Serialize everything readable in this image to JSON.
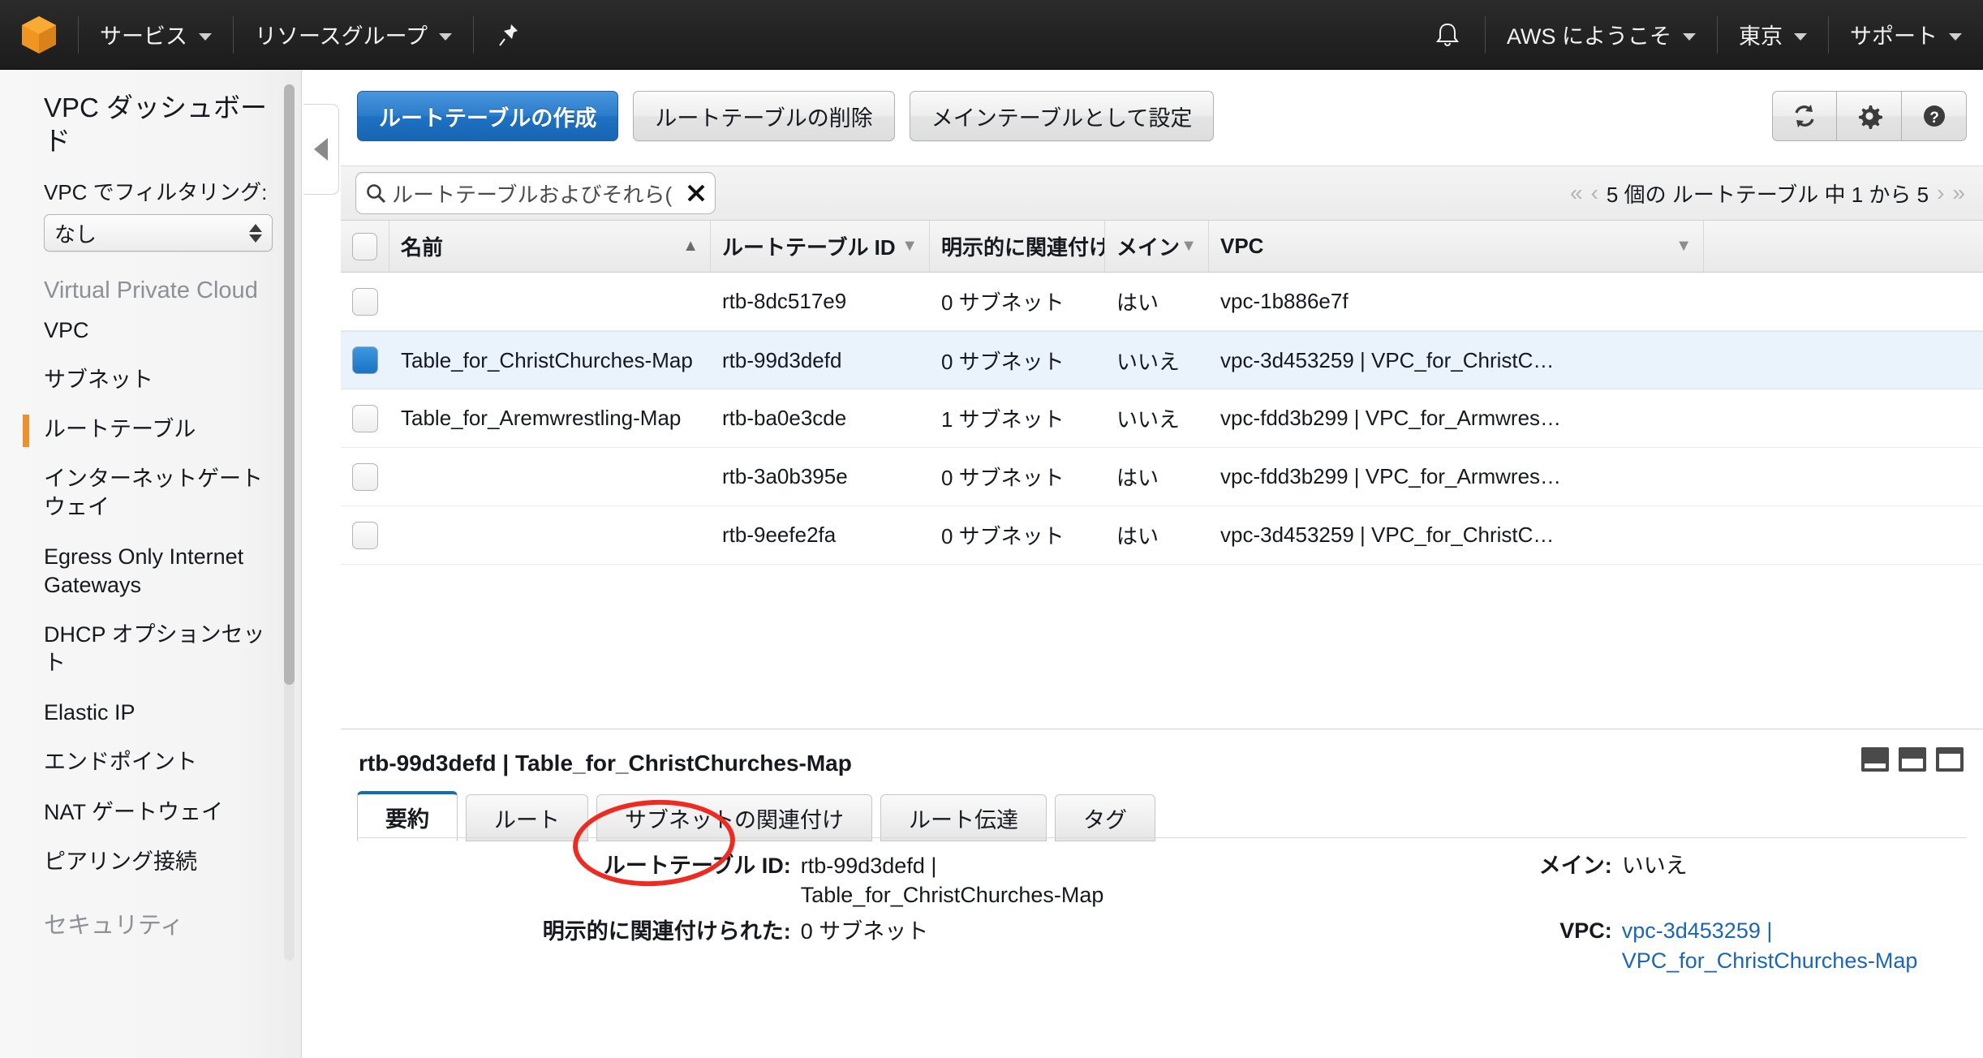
{
  "topnav": {
    "logo_icon": "aws-cube-icon",
    "services_label": "サービス",
    "resource_groups_label": "リソースグループ",
    "pin_icon": "pin-icon",
    "bell_icon": "bell-icon",
    "account_label": "AWS にようこそ",
    "region_label": "東京",
    "support_label": "サポート"
  },
  "sidebar": {
    "title": "VPC ダッシュボード",
    "filter_label": "VPC でフィルタリング:",
    "filter_value": "なし",
    "group1": "Virtual Private Cloud",
    "items": [
      {
        "label": "VPC",
        "active": false
      },
      {
        "label": "サブネット",
        "active": false
      },
      {
        "label": "ルートテーブル",
        "active": true
      },
      {
        "label": "インターネットゲートウェイ",
        "active": false
      },
      {
        "label": "Egress Only Internet Gateways",
        "active": false
      },
      {
        "label": "DHCP オプションセット",
        "active": false
      },
      {
        "label": "Elastic IP",
        "active": false
      },
      {
        "label": "エンドポイント",
        "active": false
      },
      {
        "label": "NAT ゲートウェイ",
        "active": false
      },
      {
        "label": "ピアリング接続",
        "active": false
      }
    ],
    "group2": "セキュリティ",
    "collapse_icon": "chevron-left-icon"
  },
  "toolbar": {
    "create_label": "ルートテーブルの作成",
    "delete_label": "ルートテーブルの削除",
    "set_main_label": "メインテーブルとして設定",
    "refresh_icon": "refresh-icon",
    "settings_icon": "gear-icon",
    "help_icon": "help-icon"
  },
  "search": {
    "icon": "search-icon",
    "placeholder": "ルートテーブルおよびそれら(",
    "clear_icon": "close-icon"
  },
  "pager": {
    "first_icon": "«",
    "prev_icon": "‹",
    "text": "5 個の ルートテーブル 中 1 から 5",
    "next_icon": "›",
    "last_icon": "»"
  },
  "table": {
    "columns": [
      {
        "key": "name",
        "label": "名前",
        "sort": "asc"
      },
      {
        "key": "id",
        "label": "ルートテーブル ID",
        "sort": "none"
      },
      {
        "key": "assoc",
        "label": "明示的に関連付けら",
        "sort": "none"
      },
      {
        "key": "main",
        "label": "メイン",
        "sort": "none"
      },
      {
        "key": "vpc",
        "label": "VPC",
        "sort": "none"
      }
    ],
    "rows": [
      {
        "selected": false,
        "name": "",
        "id": "rtb-8dc517e9",
        "assoc": "0 サブネット",
        "main": "はい",
        "vpc": "vpc-1b886e7f"
      },
      {
        "selected": true,
        "name": "Table_for_ChristChurches-Map",
        "id": "rtb-99d3defd",
        "assoc": "0 サブネット",
        "main": "いいえ",
        "vpc": "vpc-3d453259 | VPC_for_ChristC…"
      },
      {
        "selected": false,
        "name": "Table_for_Aremwrestling-Map",
        "id": "rtb-ba0e3cde",
        "assoc": "1 サブネット",
        "main": "いいえ",
        "vpc": "vpc-fdd3b299 | VPC_for_Armwres…"
      },
      {
        "selected": false,
        "name": "",
        "id": "rtb-3a0b395e",
        "assoc": "0 サブネット",
        "main": "はい",
        "vpc": "vpc-fdd3b299 | VPC_for_Armwres…"
      },
      {
        "selected": false,
        "name": "",
        "id": "rtb-9eefe2fa",
        "assoc": "0 サブネット",
        "main": "はい",
        "vpc": "vpc-3d453259 | VPC_for_ChristC…"
      }
    ]
  },
  "detail": {
    "title": "rtb-99d3defd | Table_for_ChristChurches-Map",
    "panel_size_icons": [
      "panel-size-small-icon",
      "panel-size-medium-icon",
      "panel-size-large-icon"
    ],
    "tabs": [
      {
        "label": "要約",
        "active": true
      },
      {
        "label": "ルート",
        "active": false
      },
      {
        "label": "サブネットの関連付け",
        "active": false
      },
      {
        "label": "ルート伝達",
        "active": false
      },
      {
        "label": "タグ",
        "active": false
      }
    ],
    "left_fields": [
      {
        "label": "ルートテーブル ID:",
        "value": "rtb-99d3defd | Table_for_ChristChurches-Map",
        "link": false
      },
      {
        "label": "明示的に関連付けられた:",
        "value": "0 サブネット",
        "link": false
      }
    ],
    "right_fields": [
      {
        "label": "メイン:",
        "value": "いいえ",
        "link": false
      },
      {
        "label": "VPC:",
        "value": "vpc-3d453259 | VPC_for_ChristChurches-Map",
        "link": true
      }
    ]
  },
  "annotation": {
    "shape": "red-ellipse-highlight",
    "target": "ルート"
  },
  "colors": {
    "accent": "#ec912d",
    "primary_button": "#1e71c3",
    "selection": "#eaf3fc",
    "annotation": "#ee2b22",
    "link": "#1b66b7"
  }
}
